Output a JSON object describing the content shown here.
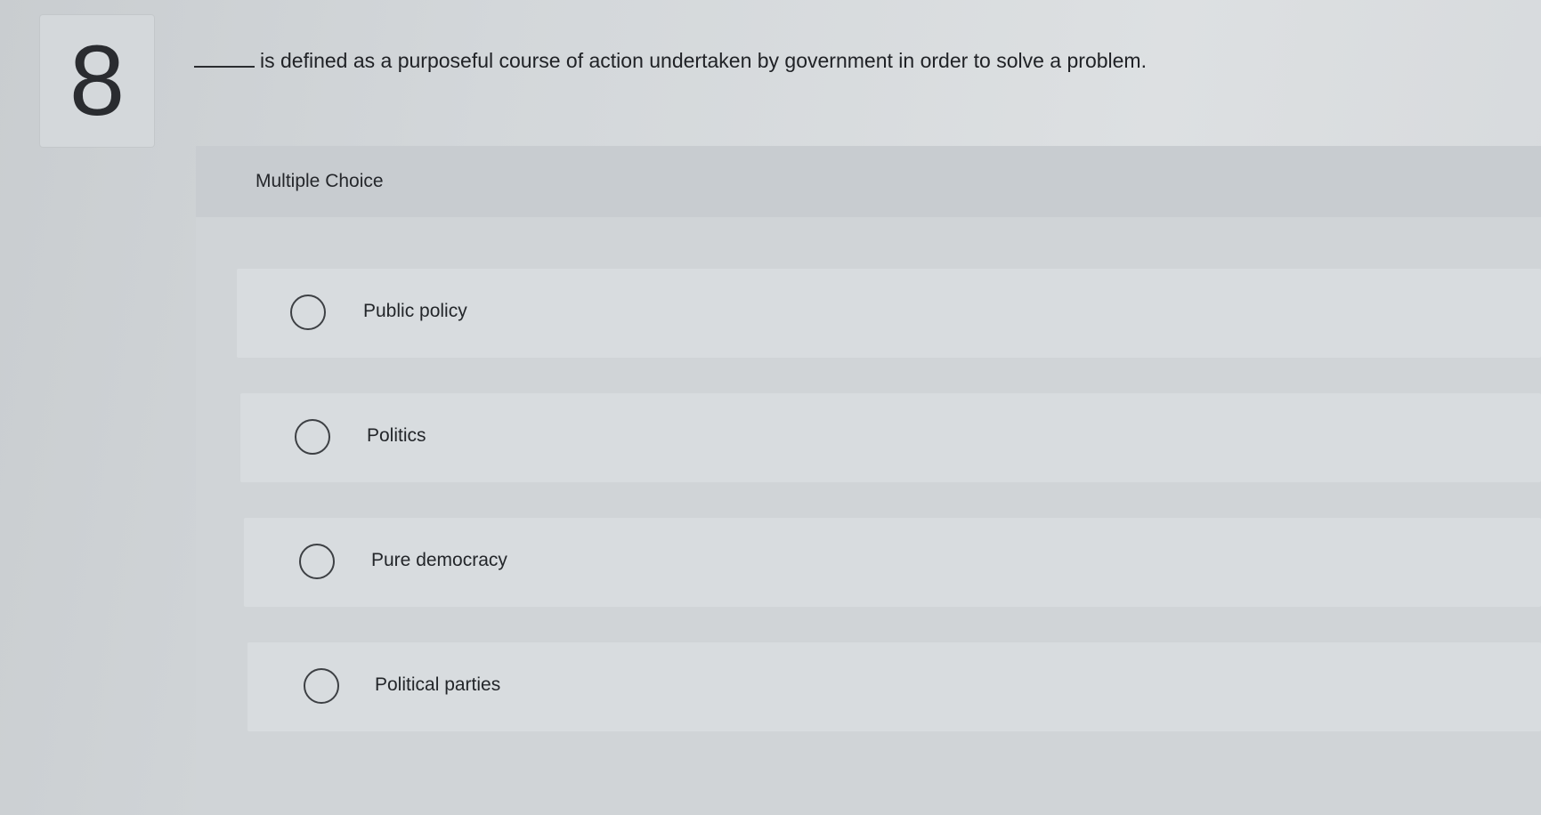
{
  "question": {
    "number": "8",
    "text": "is defined as a purposeful course of action undertaken by government in order to solve a problem."
  },
  "answer_panel": {
    "type_label": "Multiple Choice",
    "options": [
      {
        "label": "Public policy",
        "selected": false
      },
      {
        "label": "Politics",
        "selected": false
      },
      {
        "label": "Pure democracy",
        "selected": false
      },
      {
        "label": "Political parties",
        "selected": false
      }
    ]
  }
}
